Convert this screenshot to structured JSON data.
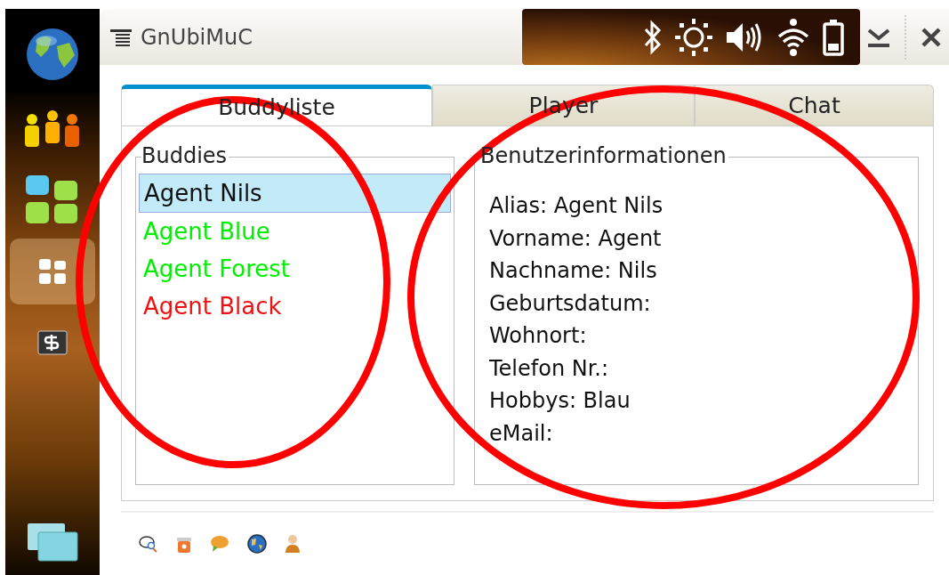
{
  "window": {
    "title": "GnUbiMuC"
  },
  "launcher": [
    {
      "kind": "globe",
      "selected": false
    },
    {
      "kind": "people",
      "selected": false
    },
    {
      "kind": "tiles",
      "selected": false
    },
    {
      "kind": "grid",
      "selected": true
    },
    {
      "kind": "terminal",
      "selected": false
    }
  ],
  "tabs": [
    {
      "label": "Buddyliste",
      "selected": true
    },
    {
      "label": "Player",
      "selected": false
    },
    {
      "label": "Chat",
      "selected": false
    }
  ],
  "buddies": {
    "legend": "Buddies",
    "items": [
      {
        "name": "Agent Nils",
        "selected": true,
        "color": "#111111"
      },
      {
        "name": "Agent Blue",
        "selected": false,
        "color": "#00ee00"
      },
      {
        "name": "Agent Forest",
        "selected": false,
        "color": "#00ee00"
      },
      {
        "name": "Agent Black",
        "selected": false,
        "color": "#ee1111"
      }
    ]
  },
  "user_info": {
    "legend": "Benutzerinformationen",
    "lines": [
      "Alias: Agent Nils",
      "Vorname: Agent",
      "Nachname: Nils",
      "Geburtsdatum:",
      "Wohnort:",
      "Telefon Nr.:",
      "Hobbys: Blau",
      "eMail:"
    ]
  },
  "toolbar": [
    {
      "kind": "search-chat"
    },
    {
      "kind": "bin"
    },
    {
      "kind": "bubble"
    },
    {
      "kind": "globe"
    },
    {
      "kind": "person"
    }
  ]
}
